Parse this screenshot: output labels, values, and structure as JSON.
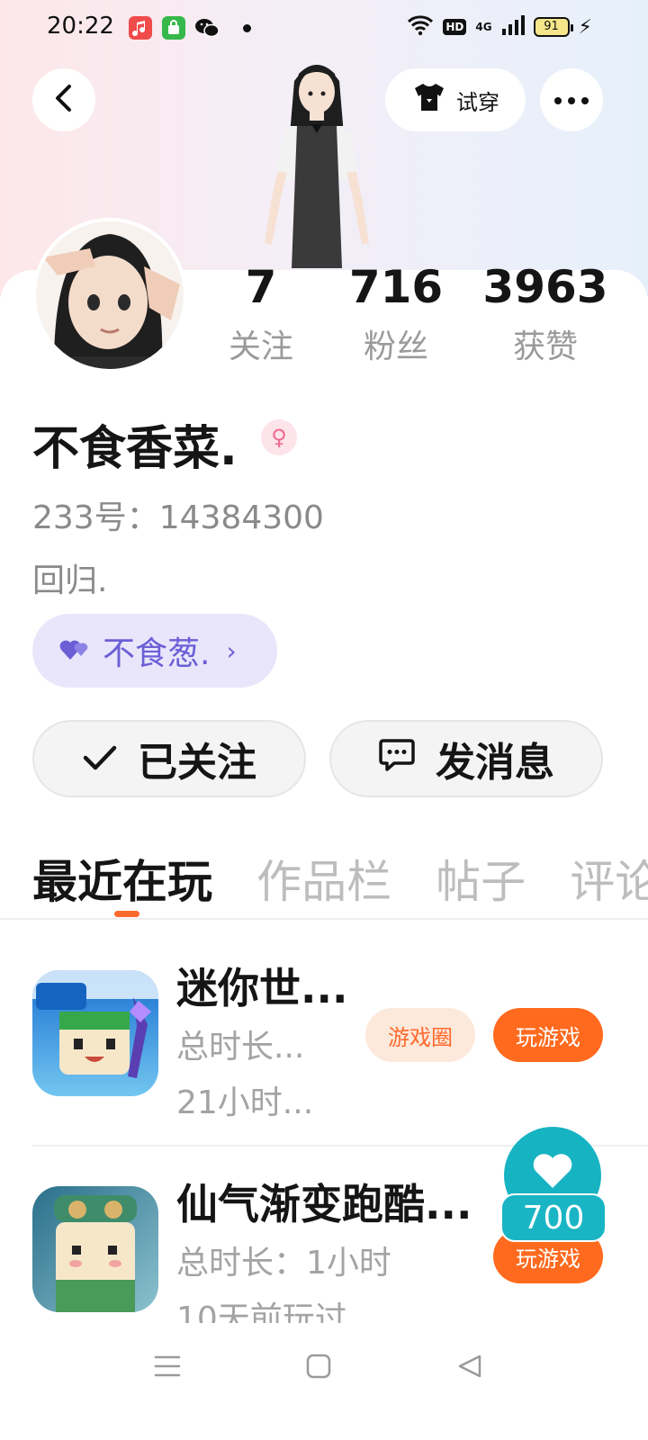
{
  "status_bar": {
    "time": "20:22",
    "hd": "HD",
    "network": "4G",
    "battery": "91"
  },
  "header": {
    "try_on_label": "试穿"
  },
  "profile": {
    "stats": [
      {
        "value": "7",
        "label": "关注"
      },
      {
        "value": "716",
        "label": "粉丝"
      },
      {
        "value": "3963",
        "label": "获赞"
      }
    ],
    "nickname": "不食香菜.",
    "user_id": "233号：14384300",
    "bio": "回归.",
    "cp_name": "不食葱."
  },
  "actions": {
    "followed_label": "已关注",
    "message_label": "发消息"
  },
  "tabs": [
    "最近在玩",
    "作品栏",
    "帖子",
    "评论"
  ],
  "games": [
    {
      "name": "迷你世...",
      "duration": "总时长...",
      "last_played": "21小时...",
      "circle_label": "游戏圈",
      "play_label": "玩游戏"
    },
    {
      "name": "仙气渐变跑酷...",
      "duration": "总时长：1小时",
      "last_played": "10天前玩过",
      "play_label": "玩游戏"
    }
  ],
  "floating_reward": {
    "count": "700"
  },
  "colors": {
    "accent_orange": "#ff6a1e",
    "teal": "#16b3c2",
    "cp_purple": "#6c5fd6"
  }
}
